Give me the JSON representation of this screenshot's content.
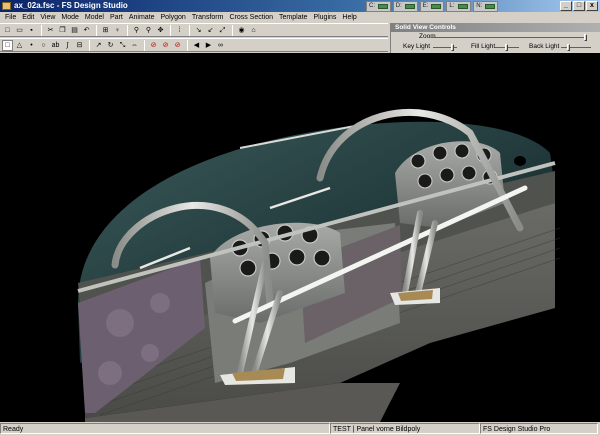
{
  "window": {
    "title": "ax_02a.fsc - FS Design Studio",
    "drives": [
      "C:",
      "D:",
      "E:",
      "L:",
      "N:"
    ],
    "controls": {
      "minimize": "_",
      "maximize": "□",
      "close": "x"
    }
  },
  "menu": [
    "File",
    "Edit",
    "View",
    "Mode",
    "Model",
    "Part",
    "Animate",
    "Polygon",
    "Transform",
    "Cross Section",
    "Template",
    "Plugins",
    "Help"
  ],
  "toolbar1": [
    "new",
    "open",
    "save",
    "cut",
    "copy",
    "paste",
    "undo",
    "grid",
    "light",
    "zoom",
    "zoom-fit",
    "move",
    "points",
    "tex-rotate",
    "tex-mirror",
    "tex-flip",
    "eye",
    "home"
  ],
  "toolbar2": [
    "rect",
    "triangle",
    "point",
    "circle",
    "text-ab",
    "bezier-s",
    "split",
    "arrow-up-right",
    "rotate",
    "scale",
    "mirror",
    "no-entry-1",
    "no-entry-2",
    "no-entry-3",
    "prev",
    "next",
    "binoculars"
  ],
  "solid_view_controls": {
    "title": "Solid View Controls",
    "zoom_label": "Zoom",
    "key_light_label": "Key Light",
    "fill_light_label": "Fill Light",
    "back_light_label": "Back Light"
  },
  "status": {
    "ready": "Ready",
    "part": "TEST | Panel vorne Bildpoly",
    "edition": "FS Design Studio Pro"
  },
  "colors": {
    "title_start": "#0a246a",
    "title_end": "#a6caf0",
    "viewport_bg": "#000000",
    "chrome": "#d4d0c8"
  }
}
